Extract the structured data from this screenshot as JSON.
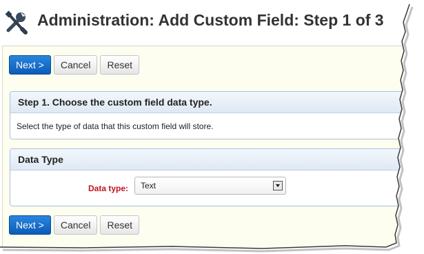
{
  "header": {
    "title": "Administration: Add Custom Field: Step 1 of 3",
    "icon": "tools-icon"
  },
  "toolbar_top": {
    "next_label": "Next >",
    "cancel_label": "Cancel",
    "reset_label": "Reset"
  },
  "step_panel": {
    "heading": "Step 1. Choose the custom field data type.",
    "description": "Select the type of data that this custom field will store."
  },
  "data_type_panel": {
    "heading": "Data Type",
    "field_label": "Data type:",
    "selected_value": "Text"
  },
  "toolbar_bottom": {
    "next_label": "Next >",
    "cancel_label": "Cancel",
    "reset_label": "Reset"
  },
  "colors": {
    "primary_button": "#0c5bb8",
    "required_label": "#c0141e",
    "content_background": "#fdfdf0",
    "panel_border": "#a9c0d6"
  }
}
